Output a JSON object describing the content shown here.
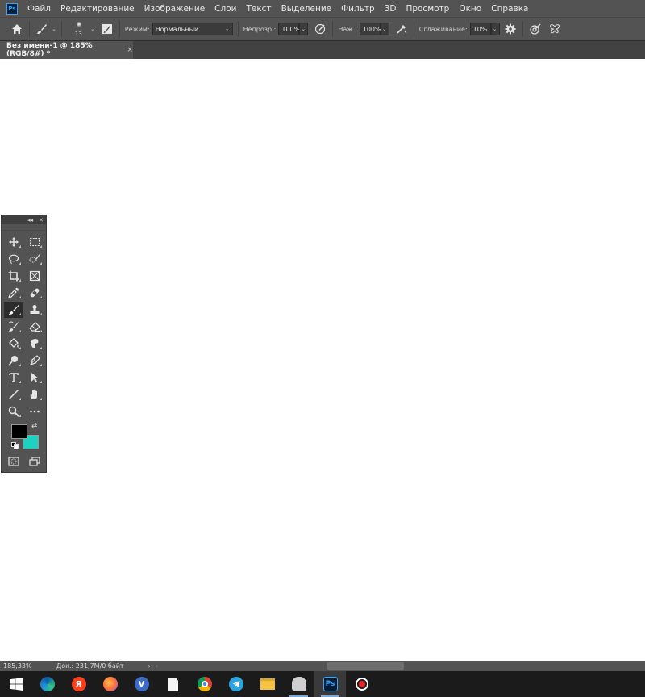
{
  "app": {
    "logo_text": "Ps",
    "menu": [
      "Файл",
      "Редактирование",
      "Изображение",
      "Слои",
      "Текст",
      "Выделение",
      "Фильтр",
      "3D",
      "Просмотр",
      "Окно",
      "Справка"
    ]
  },
  "options_bar": {
    "brush_size": "13",
    "mode_label": "Режим:",
    "mode_value": "Нормальный",
    "opacity_label": "Непрозр.:",
    "opacity_value": "100%",
    "pressure_label": "Наж.:",
    "pressure_value": "100%",
    "smoothing_label": "Сглаживание:",
    "smoothing_value": "10%"
  },
  "document": {
    "tab_title": "Без имени-1 @ 185% (RGB/8#) *",
    "tab_close": "×"
  },
  "tools_panel": {
    "collapse_glyph": "◂◂",
    "close_glyph": "✕",
    "foreground_color": "#000000",
    "background_color": "#1fd1c1",
    "tools": [
      [
        "move-tool",
        "rect-marquee-tool"
      ],
      [
        "lasso-tool",
        "quick-selection-tool"
      ],
      [
        "crop-tool",
        "frame-tool"
      ],
      [
        "eyedropper-tool",
        "healing-brush-tool"
      ],
      [
        "brush-tool",
        "clone-stamp-tool"
      ],
      [
        "history-brush-tool",
        "eraser-tool"
      ],
      [
        "paint-bucket-tool",
        "smudge-tool"
      ],
      [
        "dodge-tool",
        "pen-tool"
      ],
      [
        "type-tool",
        "path-selection-tool"
      ],
      [
        "line-tool",
        "hand-tool"
      ],
      [
        "zoom-tool",
        "more-tools"
      ]
    ],
    "active_tool": "brush-tool"
  },
  "status_bar": {
    "zoom": "185,33%",
    "doc_info": "Док.: 231,7M/0 байт",
    "arrow": "›",
    "scroll_left": "‹"
  },
  "taskbar": {
    "apps": [
      "windows-start",
      "edge",
      "yandex-browser",
      "firefox",
      "viber",
      "notepad-file",
      "chrome",
      "telegram",
      "file-explorer",
      "cloud-app",
      "photoshop",
      "screen-recorder"
    ],
    "active_app": "photoshop"
  }
}
